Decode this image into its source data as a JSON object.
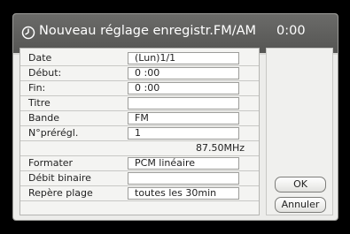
{
  "dialog": {
    "title": "Nouveau réglage enregistr.FM/AM",
    "time": "0:00",
    "icon": "clock-icon"
  },
  "fields": [
    {
      "label": "Date",
      "value": "(Lun)1/1"
    },
    {
      "label": "Début:",
      "value": "0 :00"
    },
    {
      "label": "Fin:",
      "value": "0 :00"
    },
    {
      "label": "Titre",
      "value": ""
    },
    {
      "label": "Bande",
      "value": "FM"
    },
    {
      "label": "N°prérégl.",
      "value": "1"
    }
  ],
  "frequency": "87.50MHz",
  "fields2": [
    {
      "label": "Formater",
      "value": "PCM linéaire"
    },
    {
      "label": "Débit binaire",
      "value": ""
    },
    {
      "label": "Repère plage",
      "value": "toutes les 30min"
    }
  ],
  "buttons": {
    "ok": "OK",
    "cancel": "Annuler"
  }
}
